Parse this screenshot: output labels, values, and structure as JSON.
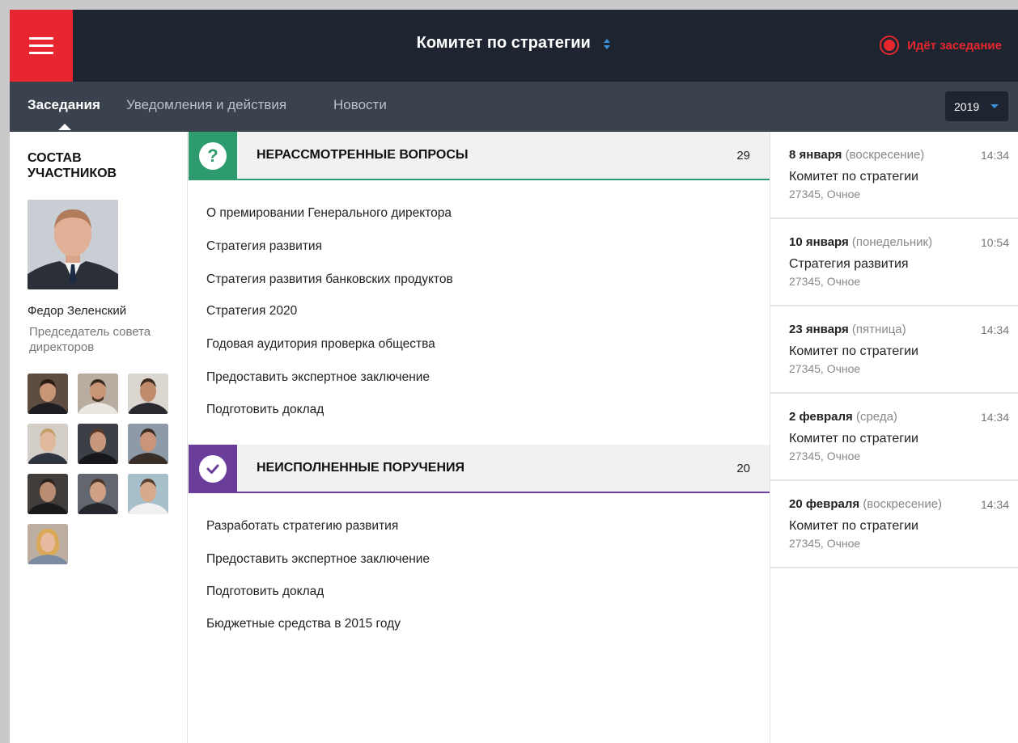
{
  "header": {
    "title": "Комитет по стратегии",
    "live_status": "Идёт заседание",
    "accent_color": "#e8262f"
  },
  "tabs": [
    {
      "label": "Заседания",
      "active": true
    },
    {
      "label": "Уведомления и действия",
      "active": false
    },
    {
      "label": "Новости",
      "active": false
    }
  ],
  "year_select": {
    "value": "2019"
  },
  "participants": {
    "heading": "СОСТАВ УЧАСТНИКОВ",
    "chair_name": "Федор Зеленский",
    "chair_role": "Председатель совета директоров"
  },
  "pending_questions": {
    "title": "НЕРАССМОТРЕННЫЕ ВОПРОСЫ",
    "count": "29",
    "color": "#2e9b6e",
    "items": [
      "О премировании Генерального директора",
      "Стратегия развития",
      "Стратегия развития банковских продуктов",
      "Стратегия 2020",
      "Годовая аудитория проверка общества",
      "Предоставить экспертное заключение",
      "Подготовить доклад"
    ]
  },
  "unfulfilled_orders": {
    "title": "НЕИСПОЛНЕННЫЕ ПОРУЧЕНИЯ",
    "count": "20",
    "color": "#6a3d9a",
    "items": [
      "Разработать стратегию развития",
      "Предоставить экспертное заключение",
      "Подготовить доклад",
      "Бюджетные средства в 2015 году"
    ]
  },
  "meetings": [
    {
      "date": "8 января",
      "weekday": "(воскресение)",
      "time": "14:34",
      "title": "Комитет по стратегии",
      "sub": "27345, Очное"
    },
    {
      "date": "10 января",
      "weekday": "(понедельник)",
      "time": "10:54",
      "title": "Стратегия развития",
      "sub": "27345, Очное"
    },
    {
      "date": "23 января",
      "weekday": "(пятница)",
      "time": "14:34",
      "title": "Комитет по стратегии",
      "sub": "27345, Очное"
    },
    {
      "date": "2 февраля",
      "weekday": "(среда)",
      "time": "14:34",
      "title": "Комитет по стратегии",
      "sub": "27345, Очное"
    },
    {
      "date": "20 февраля",
      "weekday": "(воскресение)",
      "time": "14:34",
      "title": "Комитет по стратегии",
      "sub": "27345, Очное"
    }
  ]
}
